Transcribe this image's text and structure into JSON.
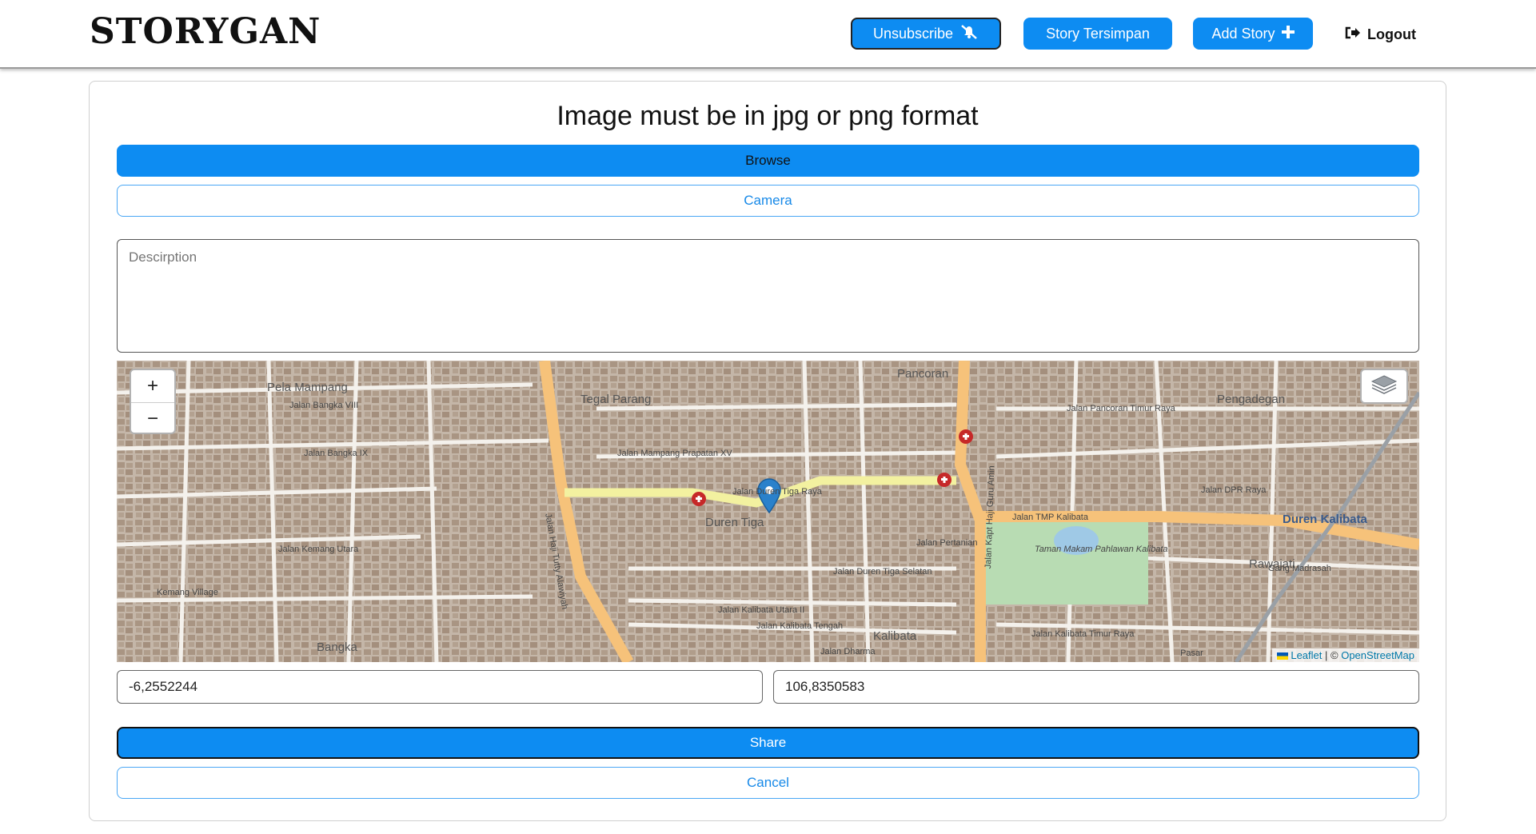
{
  "navbar": {
    "brand": "STORYGAN",
    "unsubscribe_label": "Unsubscribe",
    "saved_label": "Story Tersimpan",
    "add_story_label": "Add Story",
    "logout_label": "Logout"
  },
  "form": {
    "title": "Image must be in jpg or png format",
    "browse_label": "Browse",
    "camera_label": "Camera",
    "description_placeholder": "Descirption",
    "latitude": "-6,2552244",
    "longitude": "106,8350583",
    "share_label": "Share",
    "cancel_label": "Cancel"
  },
  "map": {
    "zoom_in": "+",
    "zoom_out": "−",
    "attribution_leaflet": "Leaflet",
    "attribution_sep": "| ©",
    "attribution_osm": "OpenStreetMap",
    "labels": {
      "pela_mampang": "Pela Mampang",
      "tegal_parang": "Tegal Parang",
      "pancoran": "Pancoran",
      "pengadegan": "Pengadegan",
      "duren_tiga": "Duren Tiga",
      "kalibata": "Kalibata",
      "duren_kalibata": "Duren Kalibata",
      "rawajati": "Rawajati",
      "bangka": "Bangka",
      "kemang_village": "Kemang Village",
      "taman_makam": "Taman Makam Pahlawan Kalibata",
      "jalan_tmp": "Jalan TMP Kalibata",
      "jalan_duren_tiga_raya": "Jalan Duren Tiga Raya",
      "jalan_kemang_utara": "Jalan Kemang Utara",
      "jalan_bangka_viii": "Jalan Bangka VIII",
      "jalan_bangka_ix": "Jalan Bangka IX",
      "jalan_pancoran_timur": "Jalan Pancoran Timur Raya",
      "jalan_duren_tiga_selatan": "Jalan Duren Tiga Selatan",
      "jalan_kalibata_tengah": "Jalan Kalibata Tengah",
      "jalan_kalibata_utara": "Jalan Kalibata Utara II",
      "jalan_mampang_prapatan": "Jalan Mampang Prapatan XV",
      "jalan_hj_tutty": "Jalan Haji Tutty Alawiyah",
      "jalan_hj_guru_amin": "Jalan Kapt Haji Guru Amin",
      "jalan_pertanian": "Jalan Pertanian",
      "jalan_dpr_raya": "Jalan DPR Raya",
      "gang_madrasah": "Gang Madrasah",
      "pasar": "Pasar",
      "jalan_dharma": "Jalan Dharma",
      "jalan_kalibata_timur": "Jalan Kalibata Timur Raya"
    }
  },
  "colors": {
    "primary": "#0d8cf2",
    "outline_text": "#1789e8",
    "road_major": "#f6c27a",
    "road_yellow": "#f3f1a0",
    "marker": "#2a81cb"
  }
}
